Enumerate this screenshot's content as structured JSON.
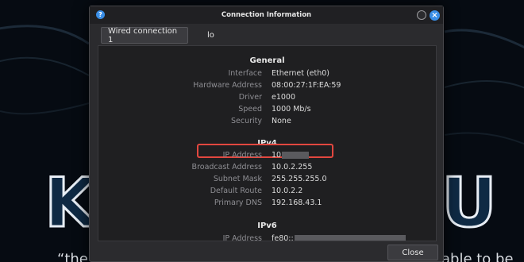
{
  "window": {
    "title": "Connection Information",
    "help_glyph": "?",
    "close_glyph": "×"
  },
  "tabs": [
    {
      "label": "Wired connection 1",
      "active": true
    },
    {
      "label": "lo",
      "active": false
    }
  ],
  "general": {
    "heading": "General",
    "rows": [
      {
        "label": "Interface",
        "value": "Ethernet (eth0)"
      },
      {
        "label": "Hardware Address",
        "value": "08:00:27:1F:EA:59"
      },
      {
        "label": "Driver",
        "value": "e1000"
      },
      {
        "label": "Speed",
        "value": "1000 Mb/s"
      },
      {
        "label": "Security",
        "value": "None"
      }
    ]
  },
  "ipv4": {
    "heading": "IPv4",
    "rows": [
      {
        "label": "IP Address",
        "value": "10"
      },
      {
        "label": "Broadcast Address",
        "value": "10.0.2.255"
      },
      {
        "label": "Subnet Mask",
        "value": "255.255.255.0"
      },
      {
        "label": "Default Route",
        "value": "10.0.2.2"
      },
      {
        "label": "Primary DNS",
        "value": "192.168.43.1"
      }
    ]
  },
  "ipv6": {
    "heading": "IPv6",
    "rows": [
      {
        "label": "IP Address",
        "value": "fe80::"
      }
    ]
  },
  "buttons": {
    "close": "Close"
  },
  "colors": {
    "accent": "#3a8ee6",
    "highlight_box": "#e2473f"
  }
}
